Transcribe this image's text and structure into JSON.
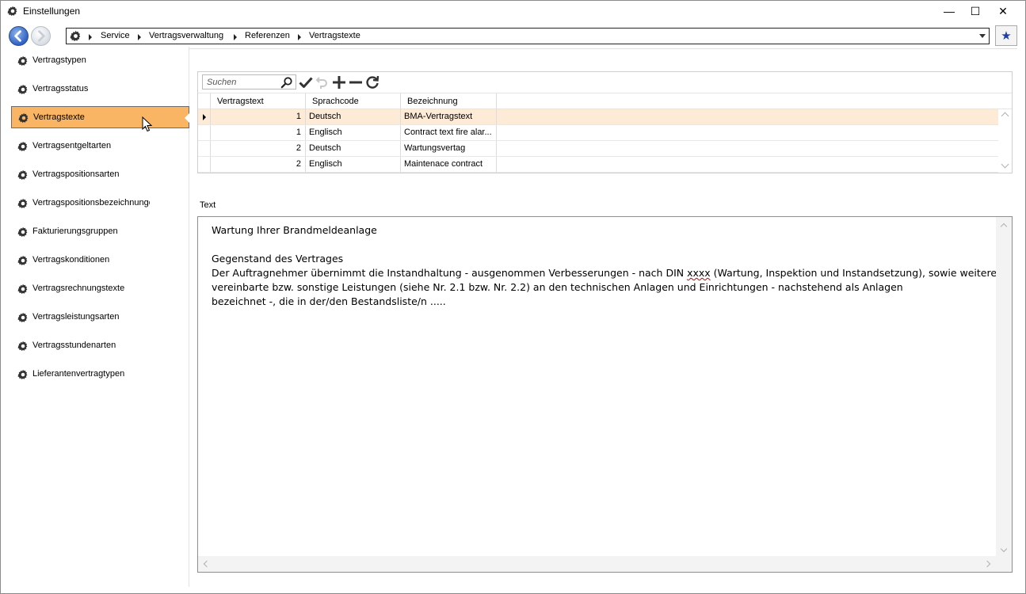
{
  "window": {
    "title": "Einstellungen",
    "controls": {
      "minimize": "—",
      "maximize": "☐",
      "close": "✕"
    }
  },
  "breadcrumb": {
    "items": [
      "Service",
      "Vertragsverwaltung",
      "Referenzen",
      "Vertragstexte"
    ]
  },
  "favorites": {
    "icon": "star-icon",
    "glyph": "★"
  },
  "sidebar": {
    "active_index": 2,
    "items": [
      {
        "label": "Vertragstypen"
      },
      {
        "label": "Vertragsstatus"
      },
      {
        "label": "Vertragstexte"
      },
      {
        "label": "Vertragsentgeltarten"
      },
      {
        "label": "Vertragspositionsarten"
      },
      {
        "label": "Vertragspositionsbezeichnungen"
      },
      {
        "label": "Fakturierungsgruppen"
      },
      {
        "label": "Vertragskonditionen"
      },
      {
        "label": "Vertragsrechnungstexte"
      },
      {
        "label": "Vertragsleistungsarten"
      },
      {
        "label": "Vertragsstundenarten"
      },
      {
        "label": "Lieferantenvertragtypen"
      }
    ]
  },
  "toolbar": {
    "search_placeholder": "Suchen",
    "icons": [
      "search-icon",
      "check-icon",
      "undo-icon",
      "add-icon",
      "remove-icon",
      "refresh-icon"
    ]
  },
  "grid": {
    "columns": [
      "Vertragstext",
      "Sprachcode",
      "Bezeichnung"
    ],
    "rows": [
      {
        "vertragstext": "1",
        "sprachcode": "Deutsch",
        "bezeichnung": "BMA-Vertragstext"
      },
      {
        "vertragstext": "1",
        "sprachcode": "Englisch",
        "bezeichnung": "Contract text fire alar..."
      },
      {
        "vertragstext": "2",
        "sprachcode": "Deutsch",
        "bezeichnung": "Wartungsvertag"
      },
      {
        "vertragstext": "2",
        "sprachcode": "Englisch",
        "bezeichnung": "Maintenace contract"
      }
    ],
    "selected_row": 0
  },
  "text_section": {
    "label": "Text",
    "line1": "Wartung Ihrer Brandmeldeanlage",
    "line2": "Gegenstand des Vertrages",
    "line3a": "Der Auftragnehmer übernimmt die Instandhaltung - ausgenommen Verbesserungen - nach DIN ",
    "line3_flagged": "xxxx",
    "line3b": " (Wartung, Inspektion und Instandsetzung), sowie weitere",
    "line4": "vereinbarte bzw. sonstige Leistungen (siehe Nr. 2.1 bzw. Nr. 2.2) an den technischen Anlagen und Einrichtungen - nachstehend als Anlagen",
    "line5": "bezeichnet -, die in der/den Bestandsliste/n ....."
  },
  "colors": {
    "active_item": "#f9b563",
    "selected_row": "#fdebd8",
    "star": "#1f3fa8"
  }
}
